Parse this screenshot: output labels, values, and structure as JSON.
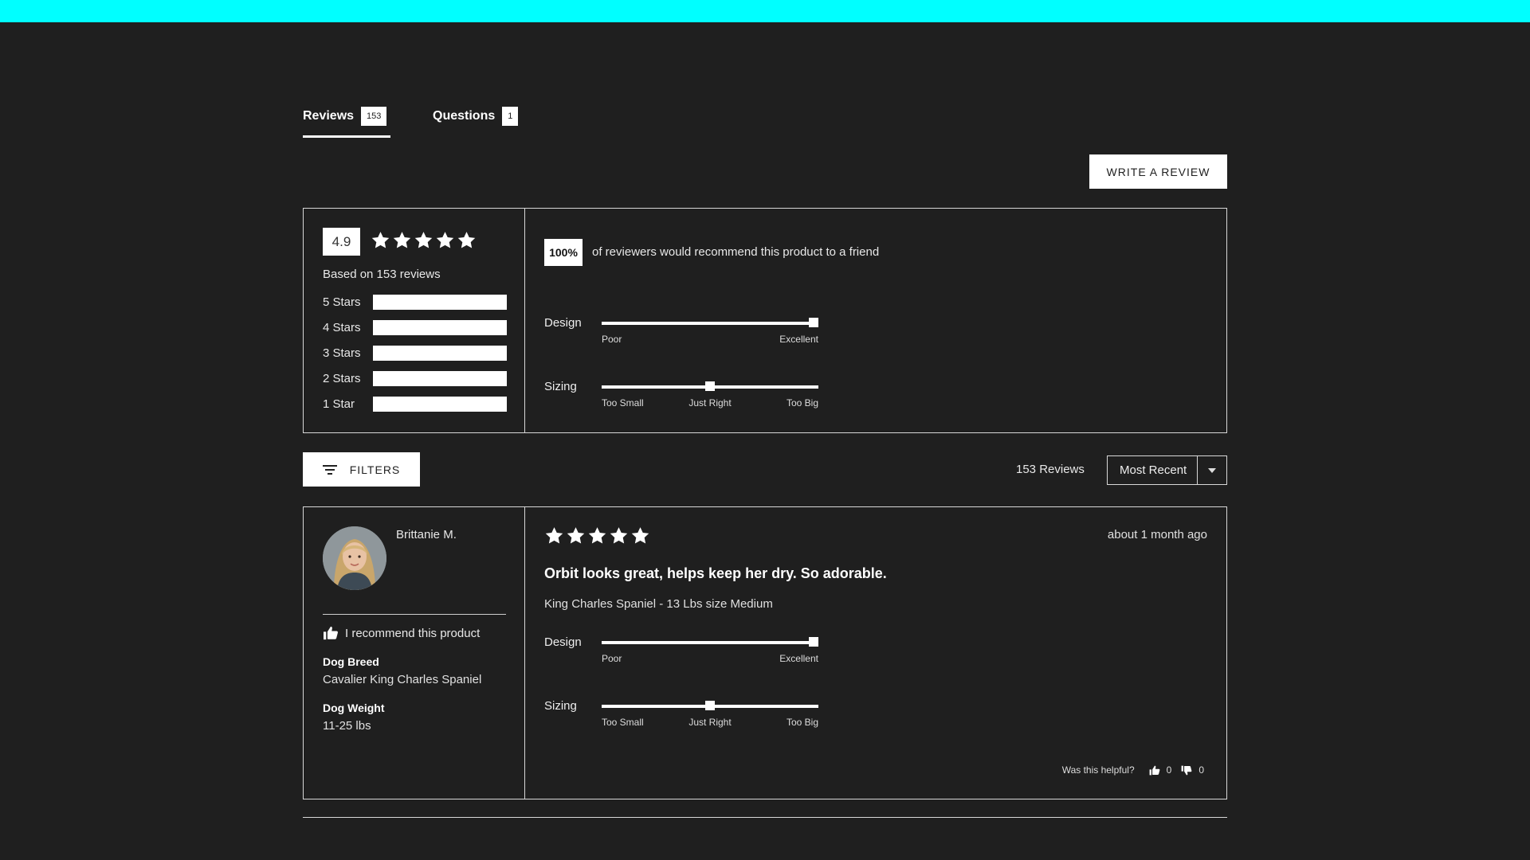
{
  "tabs": [
    {
      "label": "Reviews",
      "count": "153"
    },
    {
      "label": "Questions",
      "count": "1"
    }
  ],
  "write_review_label": "WRITE A REVIEW",
  "summary": {
    "average": "4.9",
    "stars_filled": 5,
    "based_on": "Based on 153 reviews",
    "distribution": [
      {
        "label": "5 Stars",
        "fraction": 1.0
      },
      {
        "label": "4 Stars",
        "fraction": 1.0
      },
      {
        "label": "3 Stars",
        "fraction": 1.0
      },
      {
        "label": "2 Stars",
        "fraction": 1.0
      },
      {
        "label": "1 Star",
        "fraction": 1.0
      }
    ],
    "recommend_pct": "100%",
    "recommend_text": "of reviewers would recommend this product to a friend",
    "factors": [
      {
        "name": "Design",
        "value": 1.0,
        "ticks": [
          "Poor",
          "",
          "Excellent"
        ]
      },
      {
        "name": "Sizing",
        "value": 0.5,
        "ticks": [
          "Too Small",
          "Just Right",
          "Too Big"
        ]
      }
    ]
  },
  "toolbar": {
    "filters_label": "FILTERS",
    "review_count": "153 Reviews",
    "sort_value": "Most Recent"
  },
  "review": {
    "name": "Brittanie M.",
    "recommend": "I recommend this product",
    "attributes": [
      {
        "key": "Dog Breed",
        "value": "Cavalier King Charles Spaniel"
      },
      {
        "key": "Dog Weight",
        "value": "11-25 lbs"
      }
    ],
    "stars": 5,
    "date": "about 1 month ago",
    "title": "Orbit looks great, helps keep her dry. So adorable.",
    "subtitle": "King Charles Spaniel - 13 Lbs size Medium",
    "factors": [
      {
        "name": "Design",
        "value": 1.0,
        "ticks": [
          "Poor",
          "",
          "Excellent"
        ]
      },
      {
        "name": "Sizing",
        "value": 0.5,
        "ticks": [
          "Too Small",
          "Just Right",
          "Too Big"
        ]
      }
    ],
    "helpful_label": "Was this helpful?",
    "helpful_yes": "0",
    "helpful_no": "0"
  },
  "icons": {
    "star": "star-icon",
    "filter": "filter-icon",
    "thumbs_up": "thumbs-up-icon",
    "thumbs_down": "thumbs-down-icon",
    "caret": "chevron-down-icon"
  },
  "colors": {
    "accent_bar": "#00ffff",
    "background": "#1f1f1f",
    "foreground": "#ffffff"
  }
}
